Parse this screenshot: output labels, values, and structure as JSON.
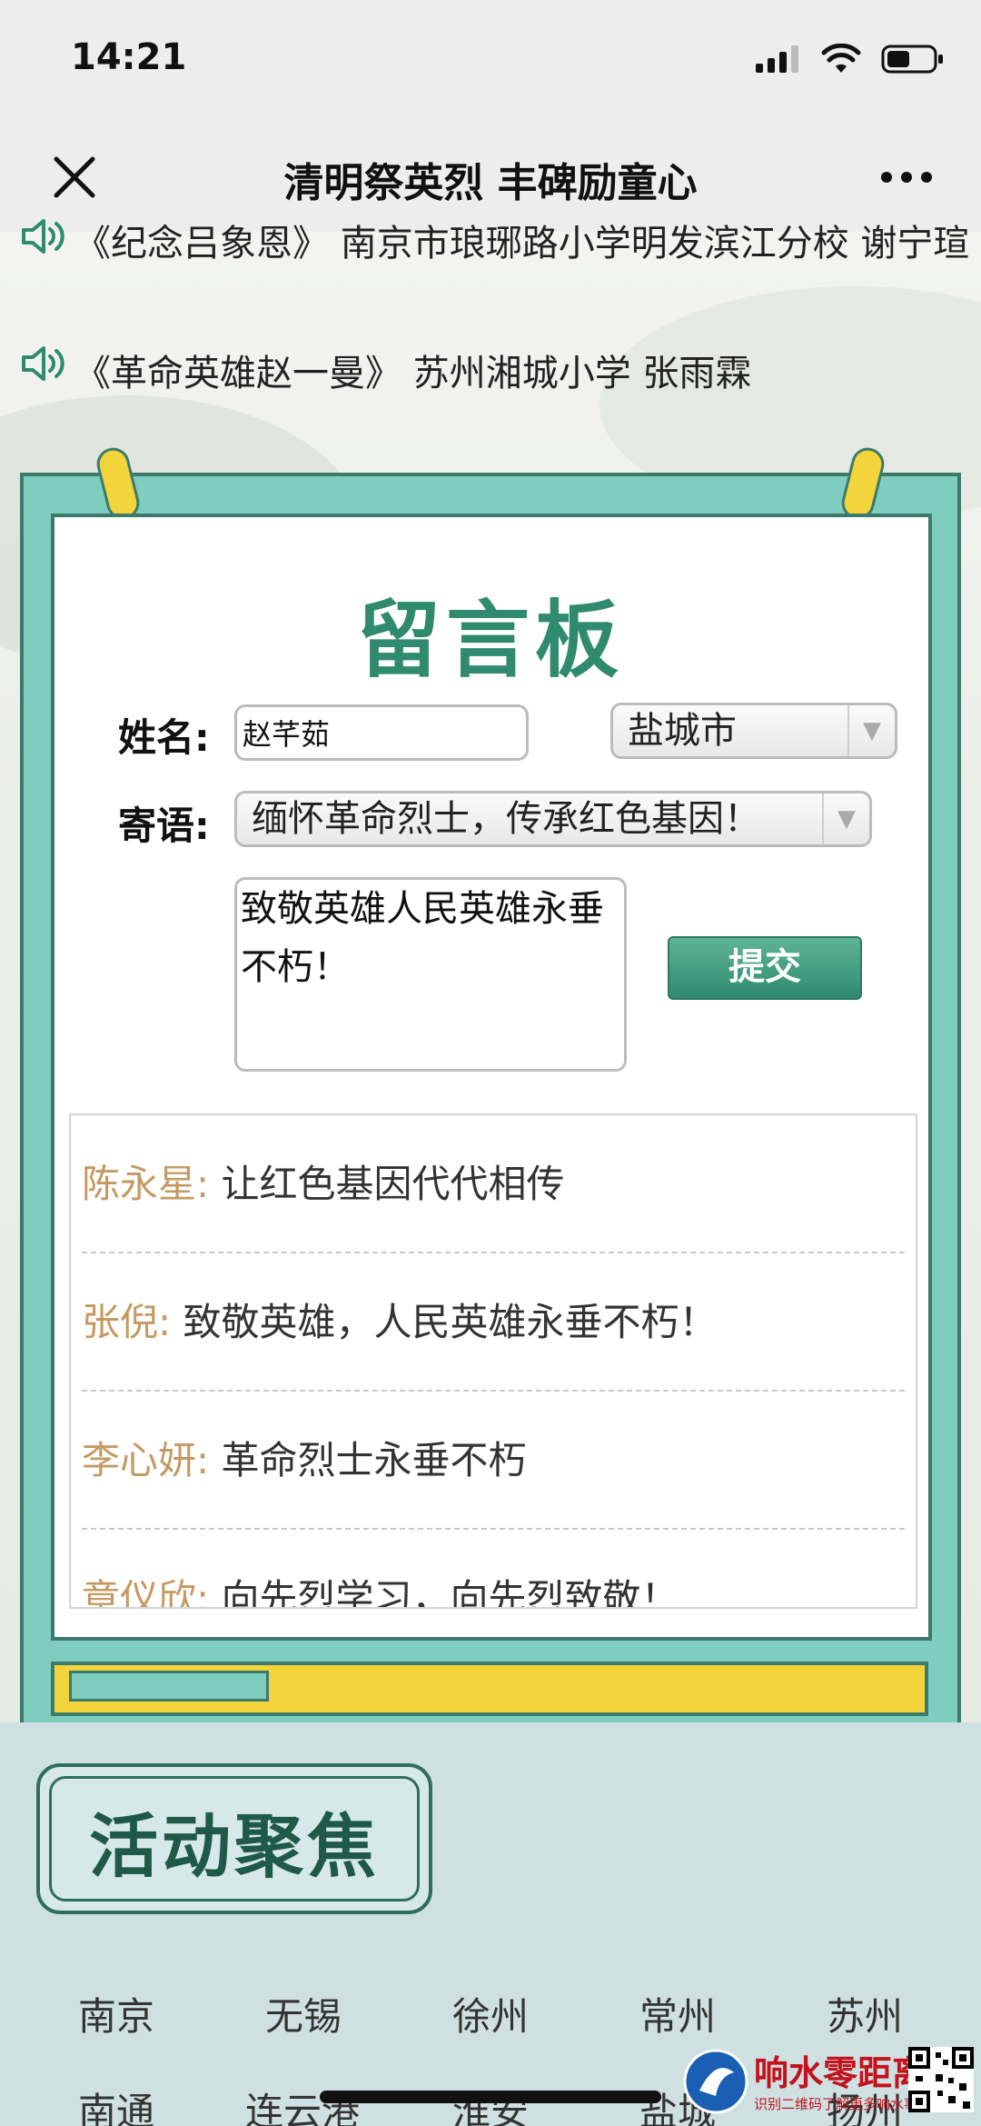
{
  "status_bar": {
    "time": "14:21"
  },
  "nav": {
    "title": "清明祭英烈 丰碑励童心"
  },
  "audio_items": [
    {
      "text": "《纪念吕象恩》 南京市琅琊路小学明发滨江分校 谢宁瑄"
    },
    {
      "text": "《革命英雄赵一曼》 苏州湘城小学 张雨霖"
    }
  ],
  "board": {
    "title": "留言板",
    "name_label": "姓名:",
    "name_value": "赵芊茹",
    "city_select": "盐城市",
    "message_label": "寄语:",
    "message_select": "缅怀革命烈士，传承红色基因！",
    "message_text": "致敬英雄人民英雄永垂不朽！",
    "submit_label": "提交"
  },
  "comments": [
    {
      "name": "陈永星:",
      "text": "让红色基因代代相传"
    },
    {
      "name": "张倪:",
      "text": "致敬英雄，人民英雄永垂不朽！"
    },
    {
      "name": "李心妍:",
      "text": "革命烈士永垂不朽"
    },
    {
      "name": "章仪欣:",
      "text": "向先烈学习，向先烈致敬！"
    }
  ],
  "activity": {
    "title": "活动聚焦",
    "cities_row1": [
      "南京",
      "无锡",
      "徐州",
      "常州",
      "苏州"
    ],
    "cities_row2": [
      "南通",
      "连云港",
      "淮安",
      "盐城",
      "扬州"
    ]
  },
  "watermark": {
    "brand": "响水零距离",
    "sub": "识别二维码了解更多响水事"
  },
  "colors": {
    "frame_teal": "#7ecdbf",
    "frame_border": "#3c7a6c",
    "title_green": "#2f8a6e",
    "clip_yellow": "#f3d43a",
    "commenter_name": "#c49a62",
    "watermark_red": "#c2121b"
  }
}
